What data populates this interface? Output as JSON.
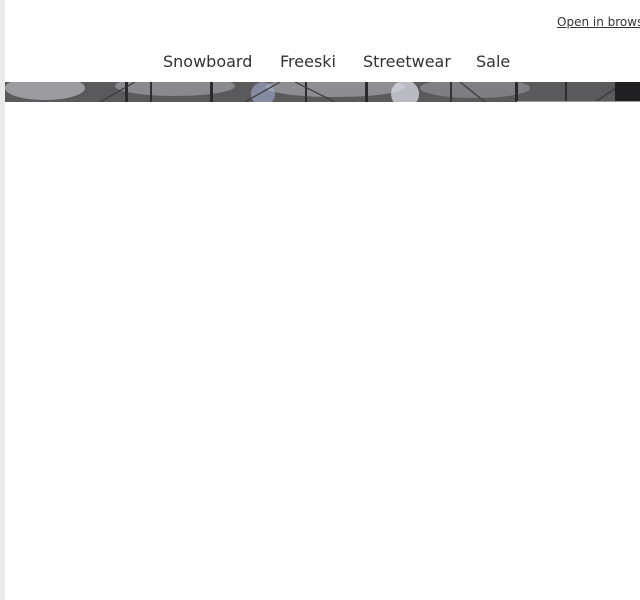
{
  "header": {
    "open_in_browser": "Open in browser"
  },
  "nav": {
    "items": [
      {
        "label": "Snowboard"
      },
      {
        "label": "Freeski"
      },
      {
        "label": "Streetwear"
      },
      {
        "label": "Sale"
      }
    ]
  },
  "hero": {
    "image": "hero-forest-photo"
  },
  "colors": {
    "page_bg": "#ebebeb",
    "content_bg": "#ffffff",
    "text": "#333333"
  }
}
